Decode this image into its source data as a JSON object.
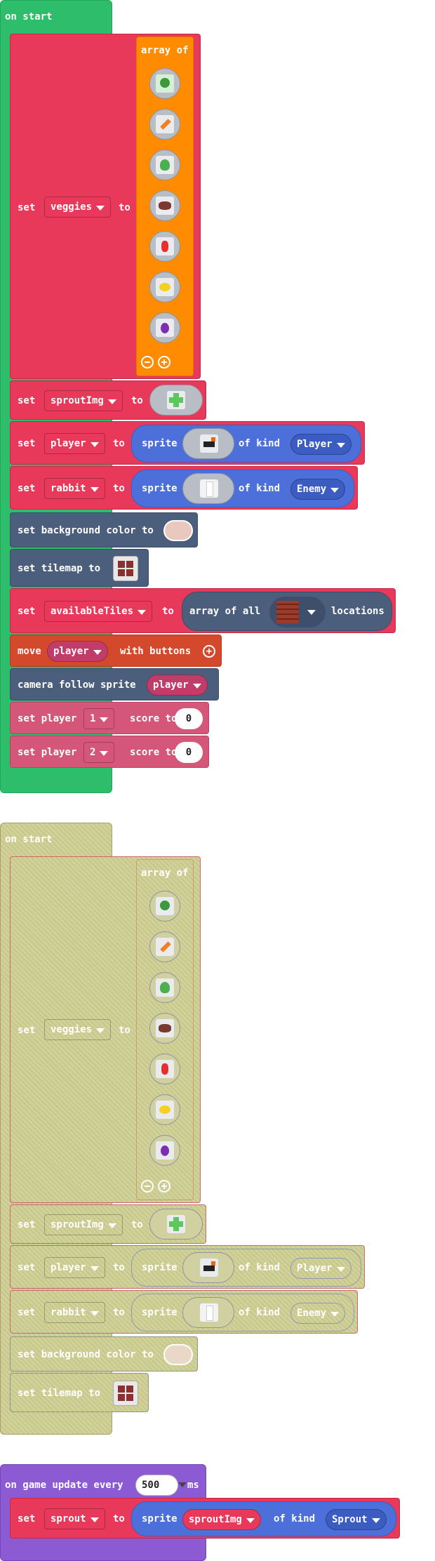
{
  "block1": {
    "hat": "on start",
    "veggies": {
      "set": "set",
      "var": "veggies",
      "to": "to",
      "array_label": "array of",
      "item_icons": [
        "broccoli-icon",
        "carrot-icon",
        "lettuce-icon",
        "meat-icon",
        "pepper-icon",
        "lemon-icon",
        "eggplant-icon"
      ],
      "minus": "⊖",
      "plus": "⊕"
    },
    "sprout": {
      "set": "set",
      "var": "sproutImg",
      "to": "to"
    },
    "player": {
      "set": "set",
      "var": "player",
      "to": "to",
      "sprite": "sprite",
      "of_kind": "of kind",
      "kind": "Player"
    },
    "rabbit": {
      "set": "set",
      "var": "rabbit",
      "to": "to",
      "sprite": "sprite",
      "of_kind": "of kind",
      "kind": "Enemy"
    },
    "bg": "set background color to",
    "tilemap": "set tilemap to",
    "tiles": {
      "set": "set",
      "var": "availableTiles",
      "to": "to",
      "array_all": "array of all",
      "locations": "locations"
    },
    "move": {
      "label": "move",
      "var": "player",
      "with": "with buttons"
    },
    "camera": {
      "label": "camera follow sprite",
      "var": "player"
    },
    "score1": {
      "set": "set player",
      "player": "1",
      "score": "score to",
      "value": "0"
    },
    "score2": {
      "set": "set player",
      "player": "2",
      "score": "score to",
      "value": "0"
    }
  },
  "block2": {
    "hat": "on start",
    "veggies": {
      "set": "set",
      "var": "veggies",
      "to": "to",
      "array_label": "array of",
      "minus": "⊖",
      "plus": "⊕"
    },
    "sprout": {
      "set": "set",
      "var": "sproutImg",
      "to": "to"
    },
    "player": {
      "set": "set",
      "var": "player",
      "to": "to",
      "sprite": "sprite",
      "of_kind": "of kind",
      "kind": "Player"
    },
    "rabbit": {
      "set": "set",
      "var": "rabbit",
      "to": "to",
      "sprite": "sprite",
      "of_kind": "of kind",
      "kind": "Enemy"
    },
    "bg": "set background color to",
    "tilemap": "set tilemap to"
  },
  "block3": {
    "hat": "on game update every",
    "interval": "500",
    "ms": "ms",
    "set": "set",
    "var": "sprout",
    "to": "to",
    "sprite": "sprite",
    "img_var": "sproutImg",
    "of_kind": "of kind",
    "kind": "Sprout"
  },
  "colors": {
    "events": "#2ebd6a",
    "variables": "#e8395a",
    "arrays": "#ff8c00",
    "scene": "#4b5f7c",
    "sprites": "#4c6fd9",
    "controller": "#d4492b",
    "info": "#d4577a",
    "game": "#8c5ad3",
    "disabled": "#c9c98c"
  }
}
